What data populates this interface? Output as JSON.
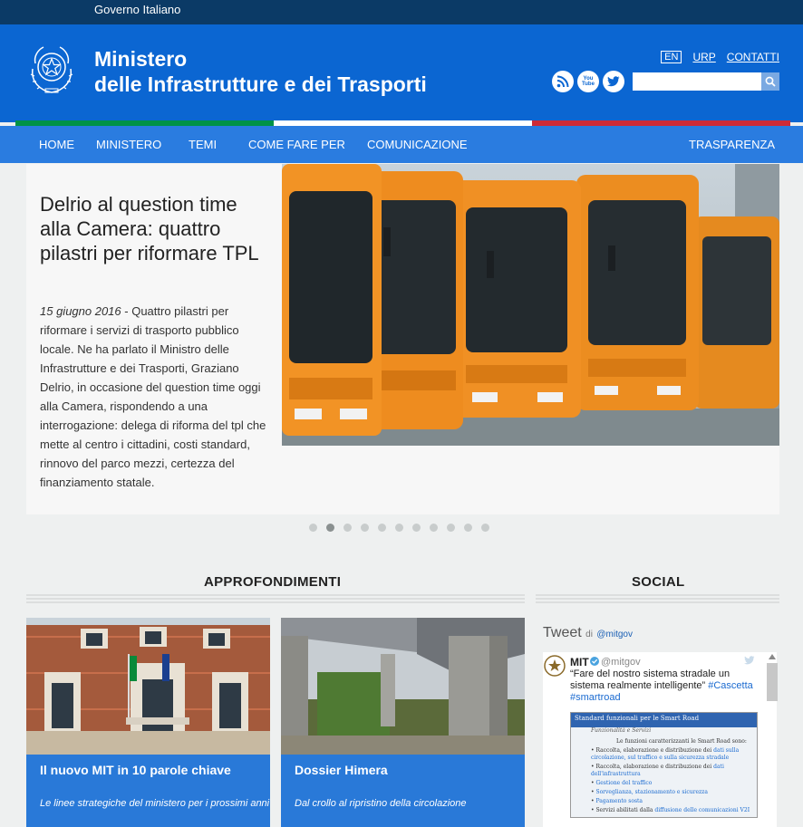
{
  "gov_bar": {
    "label": "Governo Italiano"
  },
  "header": {
    "title_line1": "Ministero",
    "title_line2": "delle Infrastrutture e dei Trasporti",
    "links": {
      "lang": "EN",
      "urp": "URP",
      "contatti": "CONTATTI"
    },
    "social": [
      "rss-icon",
      "youtube-icon",
      "twitter-icon"
    ],
    "youtube_label": "You Tube",
    "search": {
      "placeholder": ""
    }
  },
  "colors": {
    "header_blue": "#0b66d2",
    "nav_blue": "#2a7ce0",
    "flag_green": "#009246",
    "flag_white": "#ffffff",
    "flag_red": "#ce2b37"
  },
  "nav": {
    "items": [
      "HOME",
      "MINISTERO",
      "TEMI",
      "COME FARE PER",
      "COMUNICAZIONE"
    ],
    "right": "TRASPARENZA"
  },
  "hero": {
    "title": "Delrio al question time alla Camera: quattro pilastri per riformare TPL",
    "date": "15 giugno 2016",
    "text": " - Quattro pilastri per riformare i servizi di trasporto pubblico locale. Ne ha parlato il Ministro delle Infrastrutture e dei Trasporti, Graziano Delrio, in occasione del question time oggi alla Camera, rispondendo a una interrogazione: delega di riforma del tpl che mette al centro i cittadini, costi standard, rinnovo del parco mezzi, certezza del finanziamento statale.",
    "slides": 11,
    "active_slide": 2
  },
  "sections": {
    "approfondimenti": "APPROFONDIMENTI",
    "social": "SOCIAL"
  },
  "cards": [
    {
      "title": "Il nuovo MIT in 10 parole chiave",
      "subtitle": "Le linee strategiche del ministero per i prossimi anni"
    },
    {
      "title": "Dossier Himera",
      "subtitle": "Dal crollo al ripristino della circolazione"
    }
  ],
  "twitter": {
    "heading": "Tweet",
    "by": "di",
    "account": "@mitgov",
    "author_name": "MIT",
    "author_handle": "@mitgov",
    "text": "“Fare del nostro sistema stradale un sistema realmente intelligente” ",
    "hashtags": [
      "#Cascetta",
      "#smartroad"
    ],
    "media": {
      "header": "Standard funzionali per le Smart Road",
      "subheader": "Funzionalità e Servizi",
      "intro": "Le funzioni caratterizzanti le Smart Road sono:",
      "lines": [
        {
          "text": "Raccolta, elaborazione e distribuzione dei ",
          "hl": "dati sulla circolazione, sul traffico e sulla sicurezza stradale"
        },
        {
          "text": "Raccolta, elaborazione e distribuzione dei ",
          "hl": "dati dell'infrastruttura"
        },
        {
          "text": "",
          "hl": "Gestione del traffico"
        },
        {
          "text": "",
          "hl": "Sorveglianza, stazionamento e sicurezza"
        },
        {
          "text": "",
          "hl": "Pagamento sosta"
        },
        {
          "text": "Servizi abilitati dalla ",
          "hl": "diffusione delle comunicazioni V2I"
        }
      ]
    }
  }
}
